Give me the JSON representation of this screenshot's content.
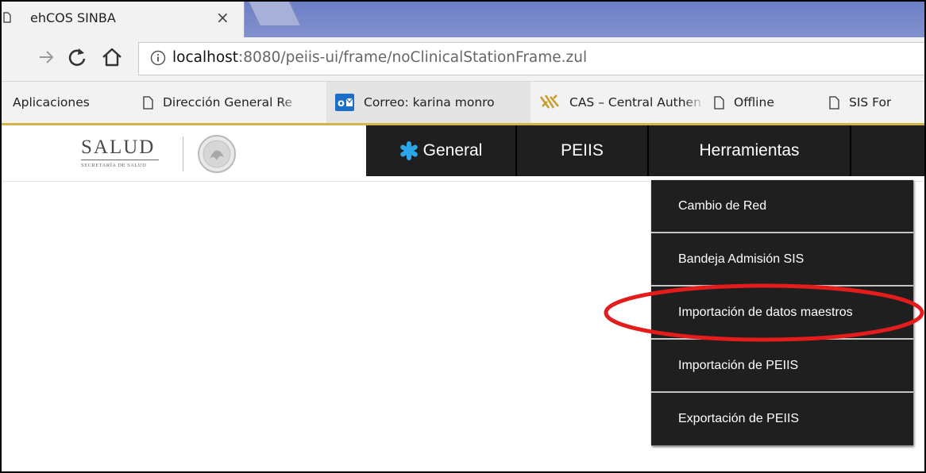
{
  "browser": {
    "tab": {
      "title": "ehCOS SINBA",
      "close_glyph": "×"
    },
    "address": {
      "url_host": "localhost",
      "url_rest": ":8080/peiis-ui/frame/noClinicalStationFrame.zul"
    },
    "bookmarks": [
      {
        "label": "Aplicaciones",
        "icon": "none"
      },
      {
        "label": "Dirección General Re",
        "icon": "doc-icon"
      },
      {
        "label": "Correo: karina monro",
        "icon": "outlook-icon"
      },
      {
        "label": "CAS – Central Authen",
        "icon": "cas-icon"
      },
      {
        "label": "Offline",
        "icon": "doc-icon"
      },
      {
        "label": "SIS For",
        "icon": "doc-icon"
      }
    ]
  },
  "header": {
    "logo_text": "SALUD",
    "logo_subtext": "SECRETARÍA DE SALUD"
  },
  "nav": {
    "items": [
      {
        "label": "General",
        "icon": "asterisk-icon"
      },
      {
        "label": "PEIIS"
      },
      {
        "label": "Herramientas"
      },
      {
        "label": ""
      }
    ]
  },
  "dropdown": {
    "items": [
      "Cambio de Red",
      "Bandeja Admisión SIS",
      "Importación de datos maestros",
      "Importación de PEIIS",
      "Exportación de PEIIS"
    ],
    "highlighted_index": 2
  },
  "colors": {
    "nav_bg": "#1f1f1f",
    "highlight_ellipse": "#e41c1c",
    "general_asterisk": "#2aa7e8",
    "bookmark_bar_accent": "#d3b546"
  }
}
